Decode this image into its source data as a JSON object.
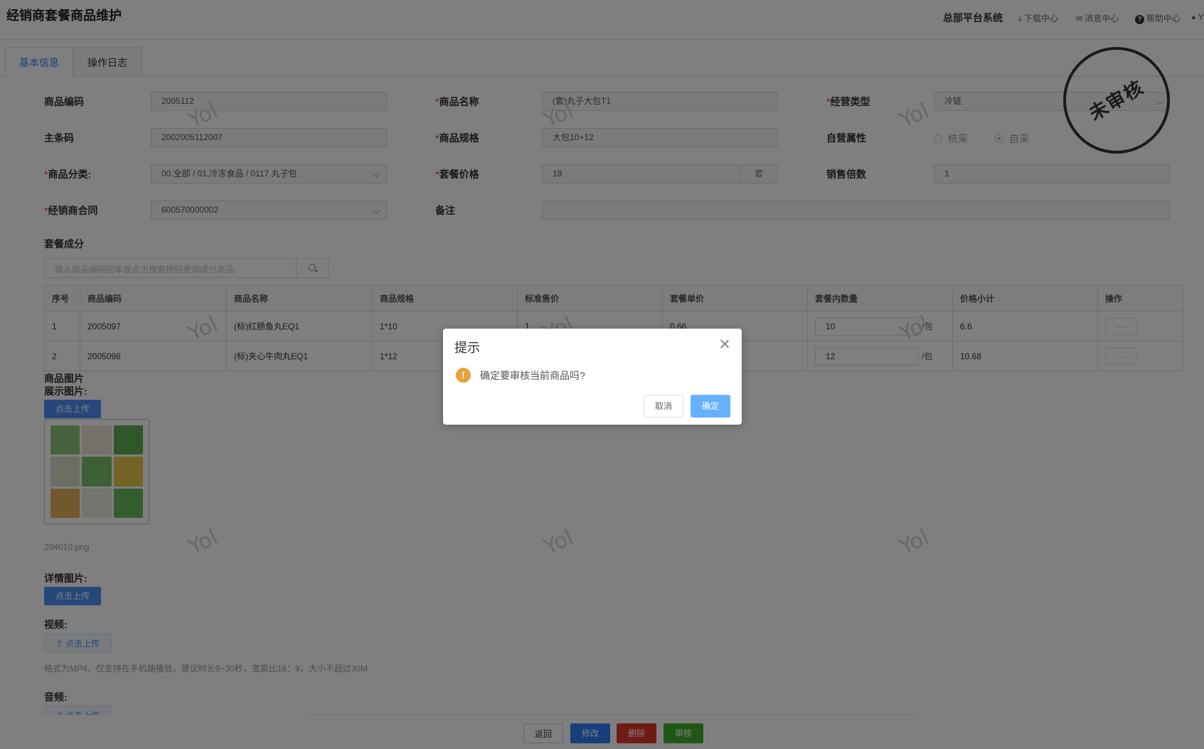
{
  "header": {
    "title": "经销商套餐商品维护",
    "system": "总部平台系统",
    "links": [
      "下载中心",
      "消息中心",
      "帮助中心",
      "Y"
    ]
  },
  "tabs": [
    "基本信息",
    "操作日志"
  ],
  "form": {
    "code_label": "商品编码",
    "code_value": "2005112",
    "name_label": "商品名称",
    "name_value": "(套)丸子大包T1",
    "biz_type_label": "经营类型",
    "biz_type_value": "冷链",
    "barcode_label": "主条码",
    "barcode_value": "2002005112007",
    "spec_label": "商品规格",
    "spec_value": "大包10+12",
    "self_attr_label": "自营属性",
    "self_attr_options": [
      "统采",
      "自采"
    ],
    "self_attr_selected": "自采",
    "category_label": "商品分类:",
    "category_value": "00.全部 / 01.冷冻食品 / 0117.丸子包",
    "price_label": "套餐价格",
    "price_value": "18",
    "price_unit": "套",
    "multiple_label": "销售倍数",
    "multiple_value": "1",
    "contract_label": "经销商合同",
    "contract_value": "600570000002",
    "remark_label": "备注",
    "remark_value": ""
  },
  "stamp": "未审核",
  "components": {
    "title": "套餐成分",
    "search_placeholder": "输入商品编码回车或点击搜索按钮查询成分商品",
    "columns": [
      "序号",
      "商品编码",
      "商品名称",
      "商品规格",
      "标准售价",
      "套餐单价",
      "套餐内数量",
      "价格小计",
      "操作"
    ],
    "rows": [
      {
        "no": "1",
        "code": "2005097",
        "name": "(标)红肠鱼丸EQ1",
        "spec": "1*10",
        "std_price": "1",
        "unit_price": "0.66",
        "qty": "10",
        "qty_unit": "/包",
        "subtotal": "6.6",
        "op": "—"
      },
      {
        "no": "2",
        "code": "2005098",
        "name": "(标)夹心牛肉丸EQ1",
        "spec": "1*12",
        "std_price": "",
        "unit_price": "",
        "qty": "12",
        "qty_unit": "/包",
        "subtotal": "10.68",
        "op": "—"
      }
    ]
  },
  "media": {
    "image_title": "商品图片",
    "display_label": "展示图片:",
    "upload_label": "点击上传",
    "file_name": "204010.png",
    "detail_label": "详情图片:",
    "video_label": "视频:",
    "video_upload_label": "⇧ 点击上传",
    "video_hint": "格式为MP4，仅支持在手机端播放，建议时长9~30秒，宽高比16：9，大小不超过30M",
    "audio_label": "音频:",
    "audio_upload_label": "⇧ 点击上传"
  },
  "footer": {
    "back": "返回",
    "edit": "修改",
    "delete": "删除",
    "audit": "审核"
  },
  "watermark": "Yol",
  "dialog": {
    "title": "提示",
    "message": "确定要审核当前商品吗?",
    "cancel": "取消",
    "confirm": "确定"
  },
  "colors": {
    "primary": "#2f7cf6",
    "danger": "#e2372d",
    "success": "#3fae2c",
    "warning": "#e6a23c",
    "dialog_ok": "#66b1ff"
  }
}
